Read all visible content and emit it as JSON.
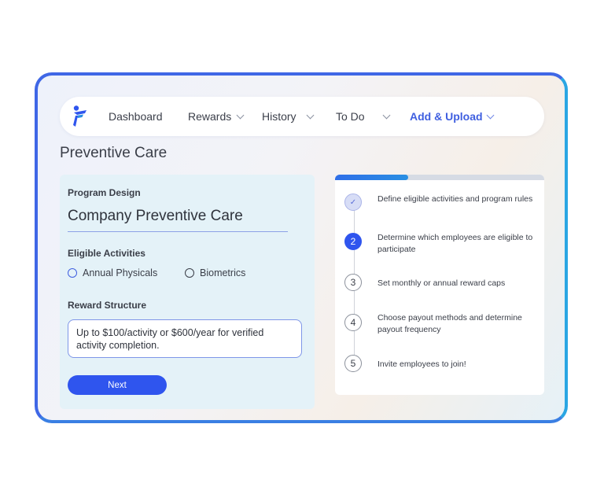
{
  "nav": {
    "items": [
      {
        "label": "Dashboard",
        "has_dropdown": false,
        "active": false
      },
      {
        "label": "Rewards",
        "has_dropdown": true,
        "active": false
      },
      {
        "label": "History",
        "has_dropdown": true,
        "active": false
      },
      {
        "label": "To Do",
        "has_dropdown": true,
        "active": false
      },
      {
        "label": "Add & Upload",
        "has_dropdown": true,
        "active": true
      }
    ]
  },
  "page": {
    "title": "Preventive Care"
  },
  "form": {
    "program_design_label": "Program Design",
    "program_name_value": "Company Preventive Care",
    "eligible_label": "Eligible Activities",
    "activities": [
      {
        "label": "Annual Physicals",
        "selected": false
      },
      {
        "label": "Biometrics",
        "selected": false
      }
    ],
    "reward_label": "Reward Structure",
    "reward_value": "Up to $100/activity or $600/year for verified activity completion.",
    "next_label": "Next"
  },
  "steps": {
    "progress_fraction": 0.35,
    "items": [
      {
        "number": "✓",
        "status": "done",
        "text": "Define eligible activities and program rules"
      },
      {
        "number": "2",
        "status": "current",
        "text": "Determine which employees are eligible to participate"
      },
      {
        "number": "3",
        "status": "pending",
        "text": "Set monthly or annual reward caps"
      },
      {
        "number": "4",
        "status": "pending",
        "text": "Choose payout methods and determine payout frequency"
      },
      {
        "number": "5",
        "status": "pending",
        "text": "Invite employees to join!"
      }
    ]
  },
  "colors": {
    "accent": "#2f55ee",
    "active_nav": "#3f5fe0",
    "frame_border": "#3f67e6",
    "form_bg": "#e4f2f8"
  },
  "icons": {
    "logo": "brand-person-icon",
    "dropdown": "chevron-down-icon",
    "done_step": "check-icon"
  }
}
